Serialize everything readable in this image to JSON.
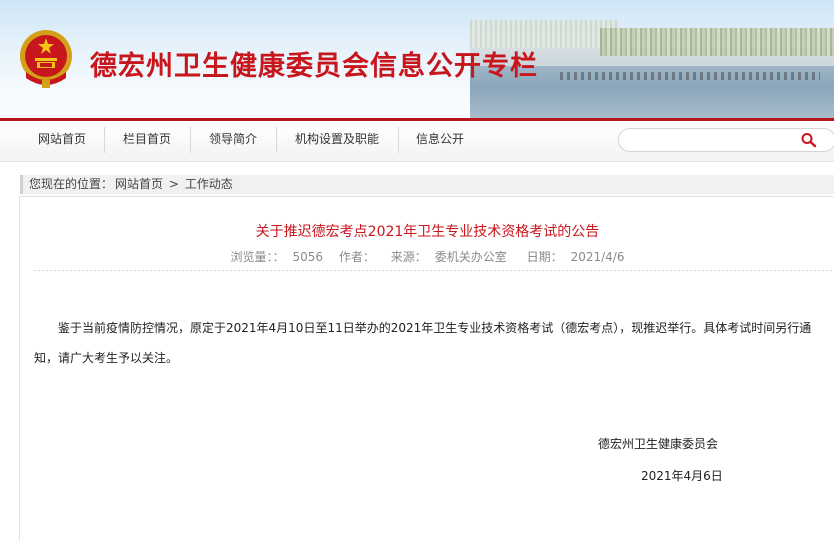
{
  "header": {
    "site_title": "德宏州卫生健康委员会信息公开专栏",
    "emblem_icon": "national-emblem-icon",
    "brand_color": "#c8161d"
  },
  "nav": {
    "items": [
      "网站首页",
      "栏目首页",
      "领导简介",
      "机构设置及职能",
      "信息公开"
    ],
    "search_placeholder": "",
    "search_icon": "search-icon"
  },
  "breadcrumb": {
    "prefix": "您现在的位置：",
    "home": "网站首页",
    "separator": ">",
    "current": "工作动态"
  },
  "article": {
    "title": "关于推迟德宏考点2021年卫生专业技术资格考试的公告",
    "views_label": "浏览量：：",
    "views": "5056",
    "author_label": "作者：",
    "source_label": "来源：",
    "source": "委机关办公室",
    "date_label": "日期：",
    "date": "2021/4/6",
    "body": "鉴于当前疫情防控情况，原定于2021年4月10日至11日举办的2021年卫生专业技术资格考试（德宏考点），现推迟举行。具体考试时间另行通知，请广大考生予以关注。",
    "signature": "德宏州卫生健康委员会",
    "sign_date": "2021年4月6日"
  }
}
